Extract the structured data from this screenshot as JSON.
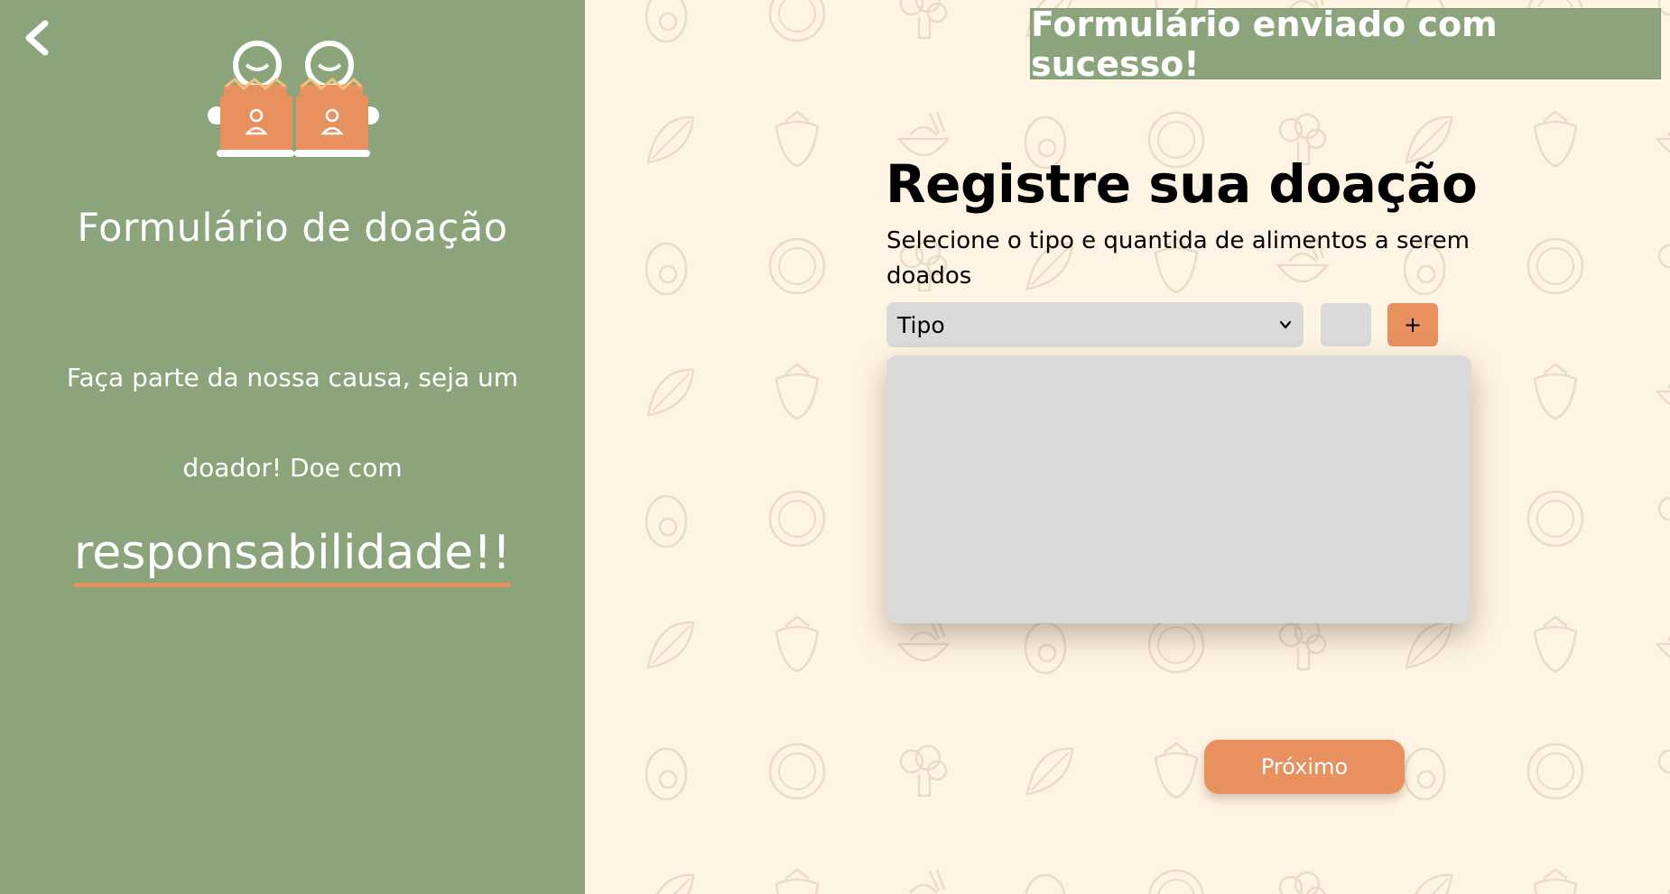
{
  "sidebar": {
    "title": "Formulário de doação",
    "line1": "Faça parte da nossa causa, seja um",
    "line2": "doador! Doe com",
    "highlight": "responsabilidade!!"
  },
  "toast": {
    "message": "Formulário enviado com sucesso!"
  },
  "form": {
    "title": "Registre sua doação",
    "subtitle": "Selecione o tipo e quantida de alimentos a serem doados",
    "type_select": {
      "selected": "Tipo"
    },
    "quantity_value": "",
    "add_label": "+",
    "next_label": "Próximo"
  },
  "colors": {
    "sidebar_green": "#8ca47b",
    "accent_orange": "#e8915f",
    "background_cream": "#fff3e3",
    "field_gray": "#d9d9d9"
  },
  "icons": {
    "back": "chevron-left-icon",
    "logo": "donation-boxes-logo-icon",
    "select": "chevron-down-icon"
  }
}
